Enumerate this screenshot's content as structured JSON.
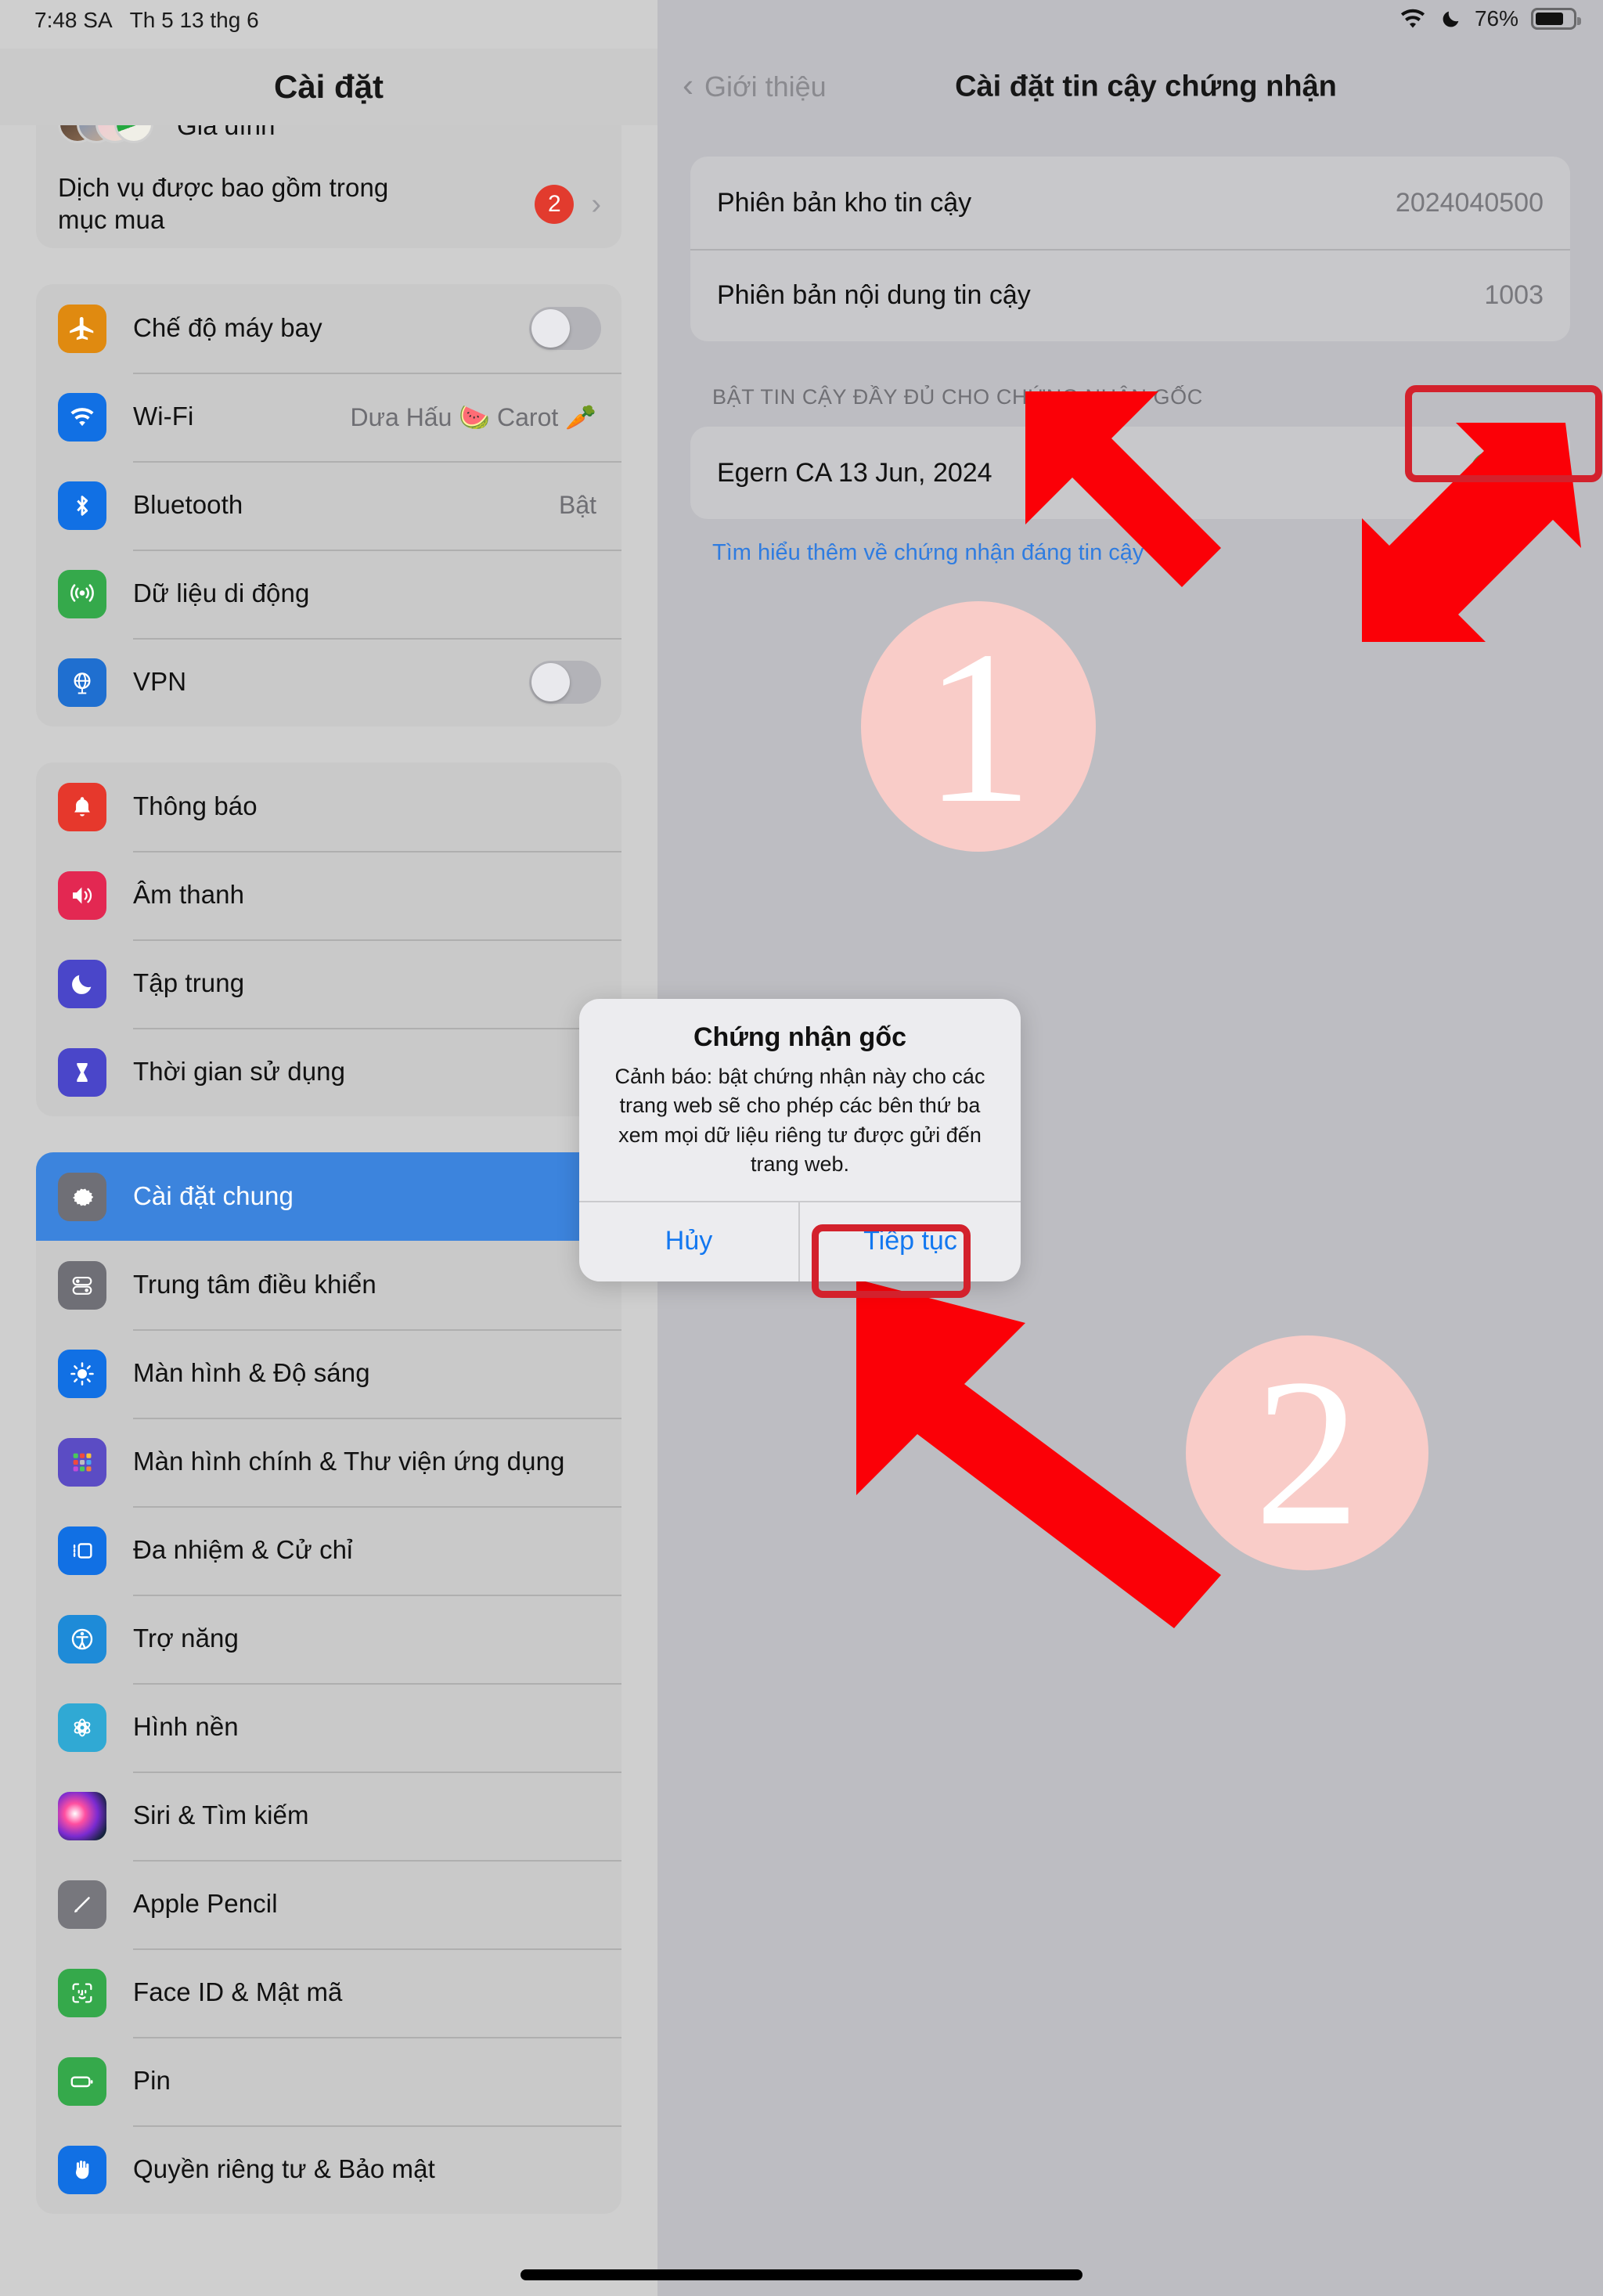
{
  "status_bar": {
    "time": "7:48 SA",
    "date": "Th 5 13 thg 6",
    "battery_percent": "76%",
    "wifi_icon": "wifi-icon",
    "focus_icon": "moon-icon",
    "battery_icon": "battery-icon"
  },
  "sidebar": {
    "title": "Cài đặt",
    "groups": [
      {
        "rows": [
          {
            "label": "Gia đình",
            "type": "avatars"
          },
          {
            "label": "Dịch vụ được bao gồm trong mục mua",
            "type": "badge",
            "badge": "2",
            "chevron": "›"
          }
        ]
      },
      {
        "rows": [
          {
            "label": "Chế độ máy bay",
            "icon": "airplane-icon",
            "icon_color": "#e08a10",
            "type": "switch-off"
          },
          {
            "label": "Wi-Fi",
            "icon": "wifi-icon",
            "icon_color": "#1170e4",
            "type": "value",
            "value": "Dưa Hấu 🍉 Carot 🥕"
          },
          {
            "label": "Bluetooth",
            "icon": "bluetooth-icon",
            "icon_color": "#1170e4",
            "type": "value",
            "value": "Bật"
          },
          {
            "label": "Dữ liệu di động",
            "icon": "cellular-icon",
            "icon_color": "#35a94b",
            "type": "plain"
          },
          {
            "label": "VPN",
            "icon": "vpn-globe-icon",
            "icon_color": "#1f6fd0",
            "type": "switch-off"
          }
        ]
      },
      {
        "rows": [
          {
            "label": "Thông báo",
            "icon": "bell-icon",
            "icon_color": "#e6382c",
            "type": "plain"
          },
          {
            "label": "Âm thanh",
            "icon": "speaker-icon",
            "icon_color": "#e32852",
            "type": "plain"
          },
          {
            "label": "Tập trung",
            "icon": "moon-icon",
            "icon_color": "#4a46c9",
            "type": "plain"
          },
          {
            "label": "Thời gian sử dụng",
            "icon": "hourglass-icon",
            "icon_color": "#4a46c9",
            "type": "plain"
          }
        ]
      },
      {
        "rows": [
          {
            "label": "Cài đặt chung",
            "icon": "gear-icon",
            "icon_color": "#6f6f76",
            "type": "plain",
            "selected": true
          },
          {
            "label": "Trung tâm điều khiển",
            "icon": "control-center-icon",
            "icon_color": "#6f6f76",
            "type": "plain"
          },
          {
            "label": "Màn hình & Độ sáng",
            "icon": "brightness-icon",
            "icon_color": "#1170e4",
            "type": "plain"
          },
          {
            "label": "Màn hình chính & Thư viện ứng dụng",
            "icon": "app-library-icon",
            "icon_color": "#5b4cc4",
            "type": "plain"
          },
          {
            "label": "Đa nhiệm & Cử chỉ",
            "icon": "multitasking-icon",
            "icon_color": "#1170e4",
            "type": "plain"
          },
          {
            "label": "Trợ năng",
            "icon": "accessibility-icon",
            "icon_color": "#1e8bd8",
            "type": "plain"
          },
          {
            "label": "Hình nền",
            "icon": "wallpaper-icon",
            "icon_color": "#30a9d4",
            "type": "plain"
          },
          {
            "label": "Siri & Tìm kiếm",
            "icon": "siri-icon",
            "icon_color": "#2b2b3c",
            "type": "plain"
          },
          {
            "label": "Apple Pencil",
            "icon": "pencil-icon",
            "icon_color": "#77777d",
            "type": "plain"
          },
          {
            "label": "Face ID & Mật mã",
            "icon": "face-id-icon",
            "icon_color": "#35a94b",
            "type": "plain"
          },
          {
            "label": "Pin",
            "icon": "battery-icon",
            "icon_color": "#35a94b",
            "type": "plain"
          },
          {
            "label": "Quyền riêng tư & Bảo mật",
            "icon": "hand-icon",
            "icon_color": "#1170e4",
            "type": "plain"
          }
        ]
      }
    ]
  },
  "detail": {
    "back_label": "Giới thiệu",
    "back_icon": "chevron-left-icon",
    "title": "Cài đặt tin cậy chứng nhận",
    "version_rows": [
      {
        "label": "Phiên bản kho tin cậy",
        "value": "2024040500"
      },
      {
        "label": "Phiên bản nội dung tin cậy",
        "value": "1003"
      }
    ],
    "section_header": "BẬT TIN CẬY ĐẦY ĐỦ CHO CHỨNG NHẬN GỐC",
    "certificate": {
      "label": "Egern CA 13 Jun, 2024",
      "toggle_state": "on"
    },
    "learn_more_link": "Tìm hiểu thêm về chứng nhận đáng tin cậy"
  },
  "alert": {
    "title": "Chứng nhận gốc",
    "message": "Cảnh báo: bật chứng nhận này cho các trang web sẽ cho phép các bên thứ ba xem mọi dữ liệu riêng tư được gửi đến trang web.",
    "cancel_label": "Hủy",
    "confirm_label": "Tiếp tục"
  },
  "annotations": {
    "step_one": "1",
    "step_two": "2",
    "highlight_color": "#d3212c",
    "arrow_color": "#fb0007",
    "circle_color": "#f9ccc8"
  }
}
